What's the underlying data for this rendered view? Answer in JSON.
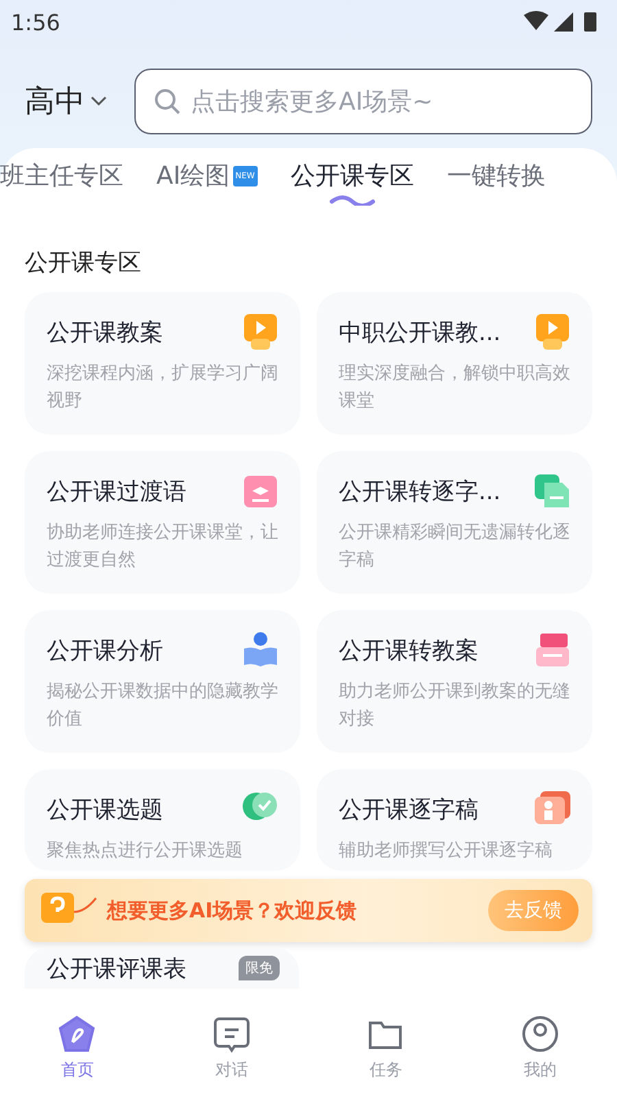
{
  "status_bar": {
    "time": "1:56"
  },
  "header": {
    "grade": "高中",
    "search": {
      "placeholder": "点击搜索更多AI场景~"
    }
  },
  "tabs": [
    {
      "label": "班主任专区",
      "selected": false
    },
    {
      "label": "AI绘图",
      "selected": false,
      "badge": "NEW"
    },
    {
      "label": "公开课专区",
      "selected": true
    },
    {
      "label": "一键转换",
      "selected": false
    }
  ],
  "section_title": "公开课专区",
  "cards": [
    {
      "title": "公开课教案",
      "description": "深挖课程内涵，扩展学习广阔视野",
      "kind": "video"
    },
    {
      "title": "中职公开课教...",
      "description": "理实深度融合，解锁中职高效课堂",
      "kind": "video"
    },
    {
      "title": "公开课过渡语",
      "description": "协助老师连接公开课课堂，让过渡更自然",
      "kind": "calendar"
    },
    {
      "title": "公开课转逐字...",
      "description": "公开课精彩瞬间无遗漏转化逐字稿",
      "kind": "document"
    },
    {
      "title": "公开课分析",
      "description": "揭秘公开课数据中的隐藏教学价值",
      "kind": "reader"
    },
    {
      "title": "公开课转教案",
      "description": "助力老师公开课到教案的无缝对接",
      "kind": "printer"
    },
    {
      "title": "公开课选题",
      "description": "聚焦热点进行公开课选题",
      "kind": "check"
    },
    {
      "title": "公开课逐字稿",
      "description": "辅助老师撰写公开课逐字稿",
      "kind": "teacher"
    }
  ],
  "banner": {
    "text": "想要更多AI场景？欢迎反馈",
    "button": "去反馈"
  },
  "partial_card": {
    "title": "公开课评课表",
    "badge": "限免"
  },
  "nav": [
    {
      "label": "首页",
      "selected": true,
      "kind": "home"
    },
    {
      "label": "对话",
      "selected": false,
      "kind": "chat"
    },
    {
      "label": "任务",
      "selected": false,
      "kind": "task"
    },
    {
      "label": "我的",
      "selected": false,
      "kind": "user"
    }
  ]
}
